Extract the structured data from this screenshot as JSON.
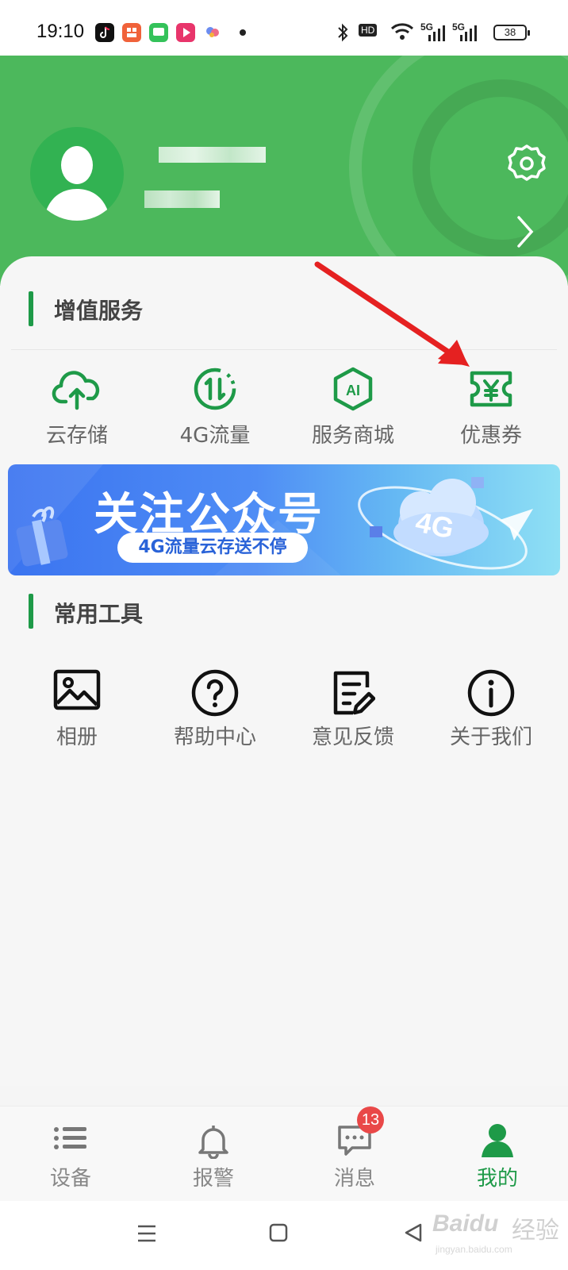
{
  "status_bar": {
    "time": "19:10",
    "hd_label": "HD",
    "net1": "5G",
    "net2": "5G",
    "battery": "38"
  },
  "profile": {
    "settings_icon": "gear-icon",
    "chevron_icon": "chevron-right-icon"
  },
  "value_services": {
    "title": "增值服务",
    "items": [
      {
        "label": "云存储",
        "icon": "cloud-upload-icon"
      },
      {
        "label": "4G流量",
        "icon": "data-flow-icon"
      },
      {
        "label": "服务商城",
        "icon": "ai-hexagon-icon"
      },
      {
        "label": "优惠券",
        "icon": "coupon-yen-icon"
      }
    ]
  },
  "banner": {
    "title": "关注公众号",
    "subtitle": "4G流量云存送不停",
    "badge": "4G"
  },
  "tools": {
    "title": "常用工具",
    "items": [
      {
        "label": "相册",
        "icon": "image-icon"
      },
      {
        "label": "帮助中心",
        "icon": "question-circle-icon"
      },
      {
        "label": "意见反馈",
        "icon": "feedback-edit-icon"
      },
      {
        "label": "关于我们",
        "icon": "info-circle-icon"
      }
    ]
  },
  "bottom_nav": {
    "items": [
      {
        "label": "设备",
        "icon": "list-icon"
      },
      {
        "label": "报警",
        "icon": "bell-icon"
      },
      {
        "label": "消息",
        "icon": "message-icon",
        "badge": "13"
      },
      {
        "label": "我的",
        "icon": "person-icon",
        "active": true
      }
    ]
  },
  "watermark": {
    "logo": "Baidu",
    "cn": "经验",
    "url": "jingyan.baidu.com"
  },
  "colors": {
    "brand_green": "#4cb85c",
    "accent_green": "#1e9a48",
    "badge_red": "#e94848",
    "annotation_red": "#e52121"
  }
}
